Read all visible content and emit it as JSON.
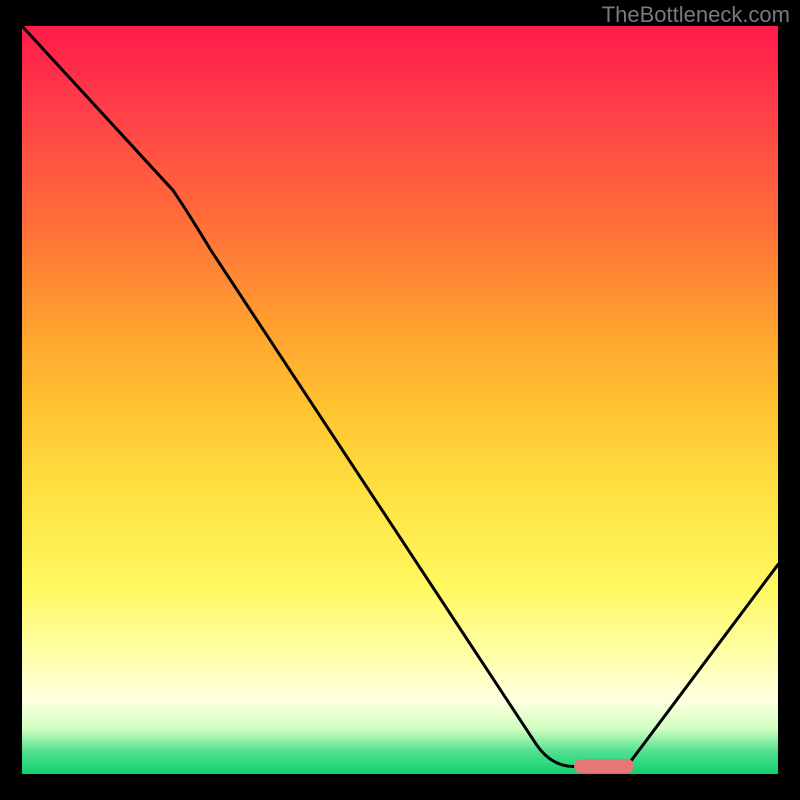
{
  "watermark": "TheBottleneck.com",
  "chart_data": {
    "type": "line",
    "title": "",
    "xlabel": "",
    "ylabel": "",
    "xlim": [
      0,
      100
    ],
    "ylim": [
      0,
      100
    ],
    "series": [
      {
        "name": "curve",
        "points": [
          {
            "x": 0,
            "y": 100
          },
          {
            "x": 20,
            "y": 78
          },
          {
            "x": 68,
            "y": 4
          },
          {
            "x": 73,
            "y": 1
          },
          {
            "x": 80,
            "y": 1
          },
          {
            "x": 100,
            "y": 28
          }
        ]
      }
    ],
    "marker": {
      "x_start": 73,
      "x_end": 81,
      "y": 1.2,
      "color": "#e87878"
    },
    "gradient_stops": [
      {
        "pos": 0,
        "color": "#ff1a4a"
      },
      {
        "pos": 25,
        "color": "#ff6a3a"
      },
      {
        "pos": 50,
        "color": "#ffc030"
      },
      {
        "pos": 75,
        "color": "#fff860"
      },
      {
        "pos": 90,
        "color": "#ffffe0"
      },
      {
        "pos": 100,
        "color": "#10d070"
      }
    ]
  }
}
